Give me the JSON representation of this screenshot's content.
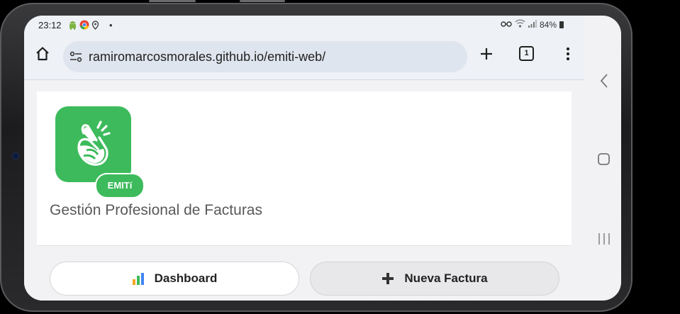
{
  "status_bar": {
    "time": "23:12",
    "separator": "•",
    "battery": "84%",
    "notification_icons": [
      "android-icon",
      "chrome-icon",
      "location-icon"
    ],
    "status_icons": [
      "key-icon",
      "wifi-icon",
      "signal-icon",
      "battery-icon"
    ]
  },
  "browser": {
    "url": "ramiromarcosmorales.github.io/emiti-web/",
    "tab_count": "1"
  },
  "page": {
    "brand_badge": "EMITí",
    "subtitle": "Gestión Profesional de Facturas",
    "buttons": {
      "dashboard": "Dashboard",
      "new_invoice": "Nueva Factura"
    }
  },
  "colors": {
    "brand_green": "#3dbb5c",
    "background": "#f2f2f5",
    "url_bar": "#dfe5ee"
  }
}
